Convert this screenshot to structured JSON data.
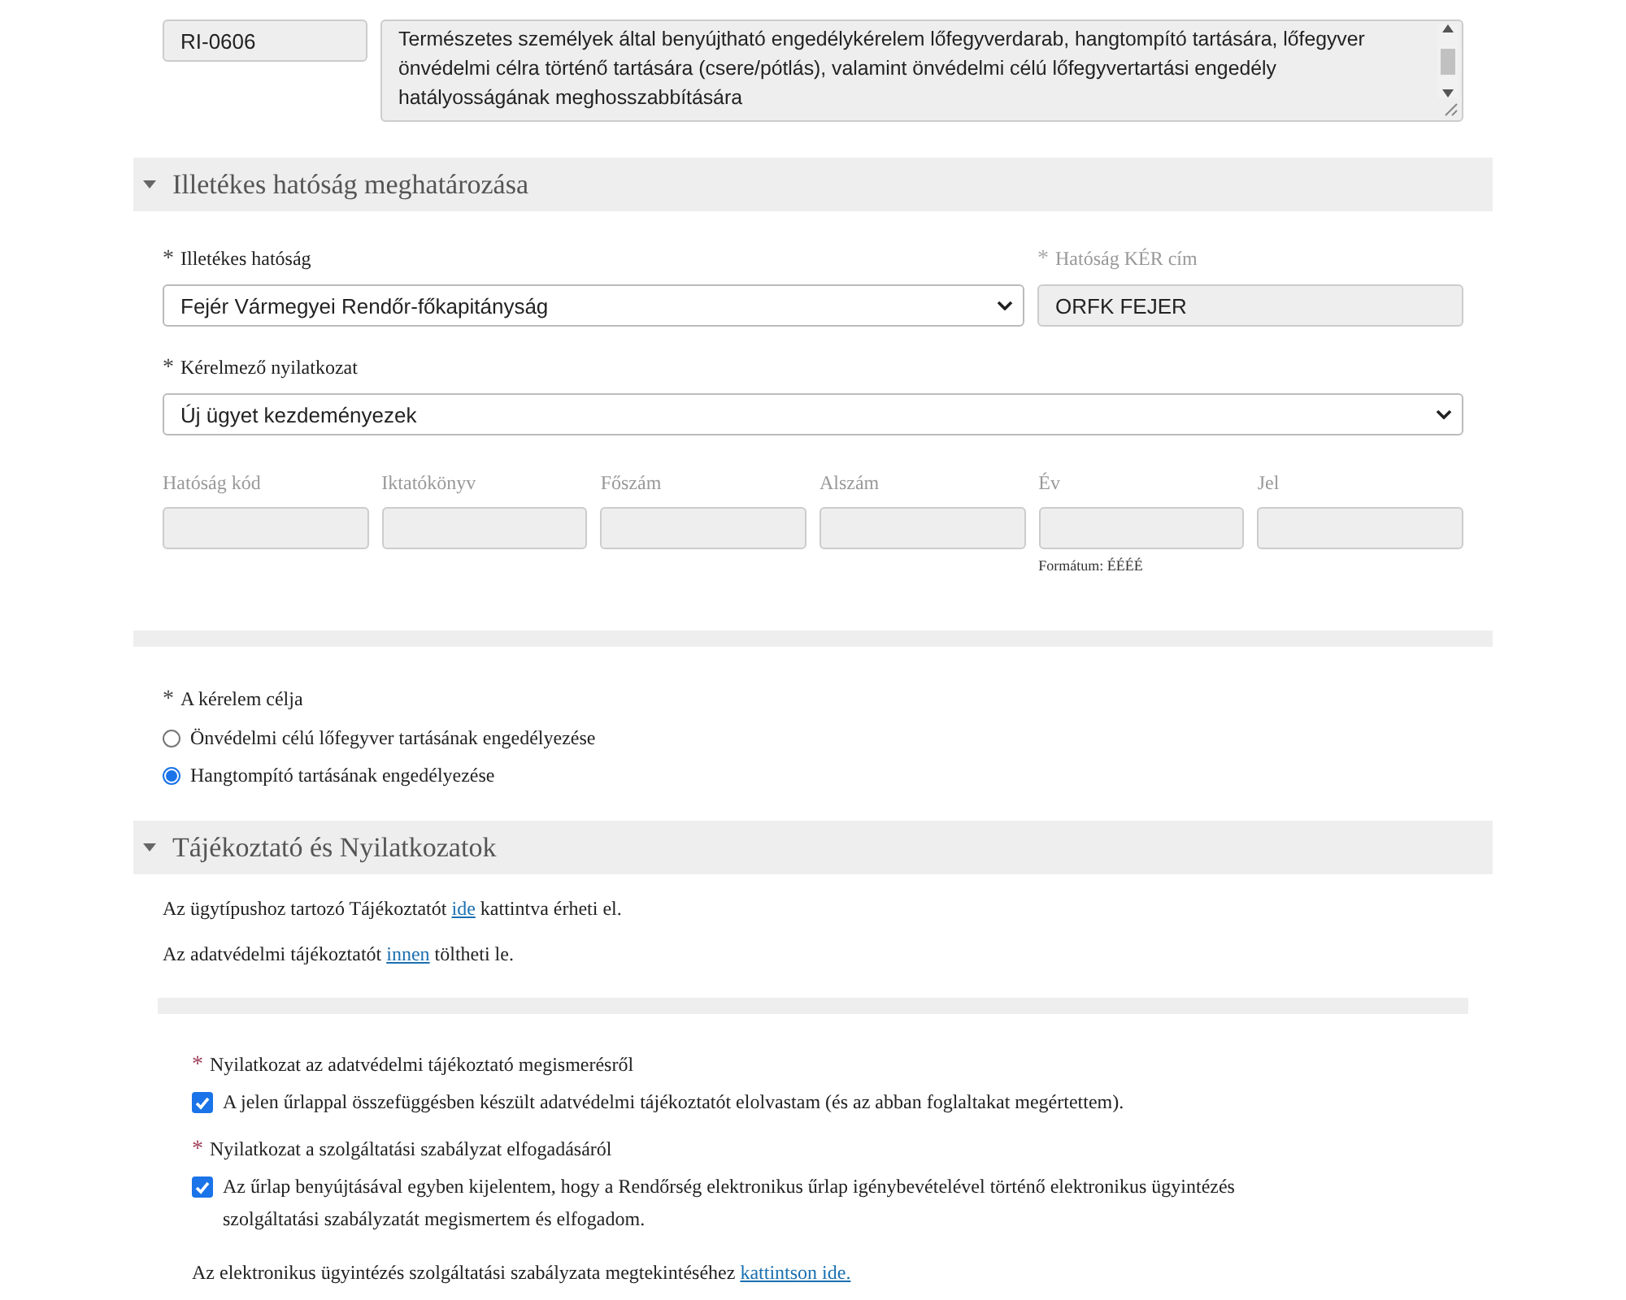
{
  "top_row": {
    "code": {
      "value": "RI-0606",
      "disabled": true
    },
    "description": {
      "value": "Természetes személyek által benyújtható engedélykérelem lőfegyverdarab, hangtompító tartására, lőfegyver önvédelmi célra történő tartására (csere/pótlás), valamint önvédelmi célú lőfegyvertartási engedély hatályosságának meghosszabbítására",
      "disabled": true
    }
  },
  "authority_section": {
    "title": "Illetékes hatóság meghatározása",
    "expanded": true,
    "authority": {
      "mark": "*",
      "label": "Illetékes hatóság",
      "value": "Fejér Vármegyei Rendőr-főkapitányság",
      "disabled": false
    },
    "ker_address": {
      "mark": "*",
      "label": "Hatóság KÉR cím",
      "value": "ORFK FEJER",
      "disabled": true
    },
    "statement": {
      "mark": "*",
      "label": "Kérelmező nyilatkozat",
      "value": "Új ügyet kezdeményezek",
      "disabled": false
    },
    "reference_fields": [
      {
        "label": "Hatóság kód",
        "disabled": true
      },
      {
        "label": "Iktatókönyv",
        "disabled": true
      },
      {
        "label": "Főszám",
        "disabled": true
      },
      {
        "label": "Alszám",
        "disabled": true
      },
      {
        "label": "Év",
        "disabled": true,
        "hint": "Formátum: ÉÉÉÉ"
      },
      {
        "label": "Jel",
        "disabled": true
      }
    ]
  },
  "purpose": {
    "mark": "*",
    "label": "A kérelem célja",
    "options": [
      {
        "label": "Önvédelmi célú lőfegyver tartásának engedélyezése",
        "selected": false
      },
      {
        "label": "Hangtompító tartásának engedélyezése",
        "selected": true
      }
    ]
  },
  "info_section": {
    "title": "Tájékoztató és Nyilatkozatok",
    "expanded": true,
    "lines": [
      {
        "before": "Az ügytípushoz tartozó Tájékoztatót ",
        "link": "ide",
        "after": " kattintva érheti el."
      },
      {
        "before": "Az adatvédelmi tájékoztatót ",
        "link": "innen",
        "after": " töltheti le."
      }
    ],
    "declarations": [
      {
        "mark": "*",
        "title": "Nyilatkozat az adatvédelmi tájékoztató megismerésről",
        "text": "A jelen űrlappal összefüggésben készült adatvédelmi tájékoztatót elolvastam (és az abban foglaltakat megértettem).",
        "checked": true
      },
      {
        "mark": "*",
        "title": "Nyilatkozat a szolgáltatási szabályzat elfogadásáról",
        "text": "Az űrlap benyújtásával egyben kijelentem, hogy a Rendőrség elektronikus űrlap igénybevételével történő elektronikus ügyintézés szolgáltatási szabályzatát megismertem és elfogadom.",
        "checked": true
      }
    ],
    "footer": {
      "before": "Az elektronikus ügyintézés szolgáltatási szabályzata megtekintéséhez ",
      "link": "kattintson ide."
    }
  }
}
